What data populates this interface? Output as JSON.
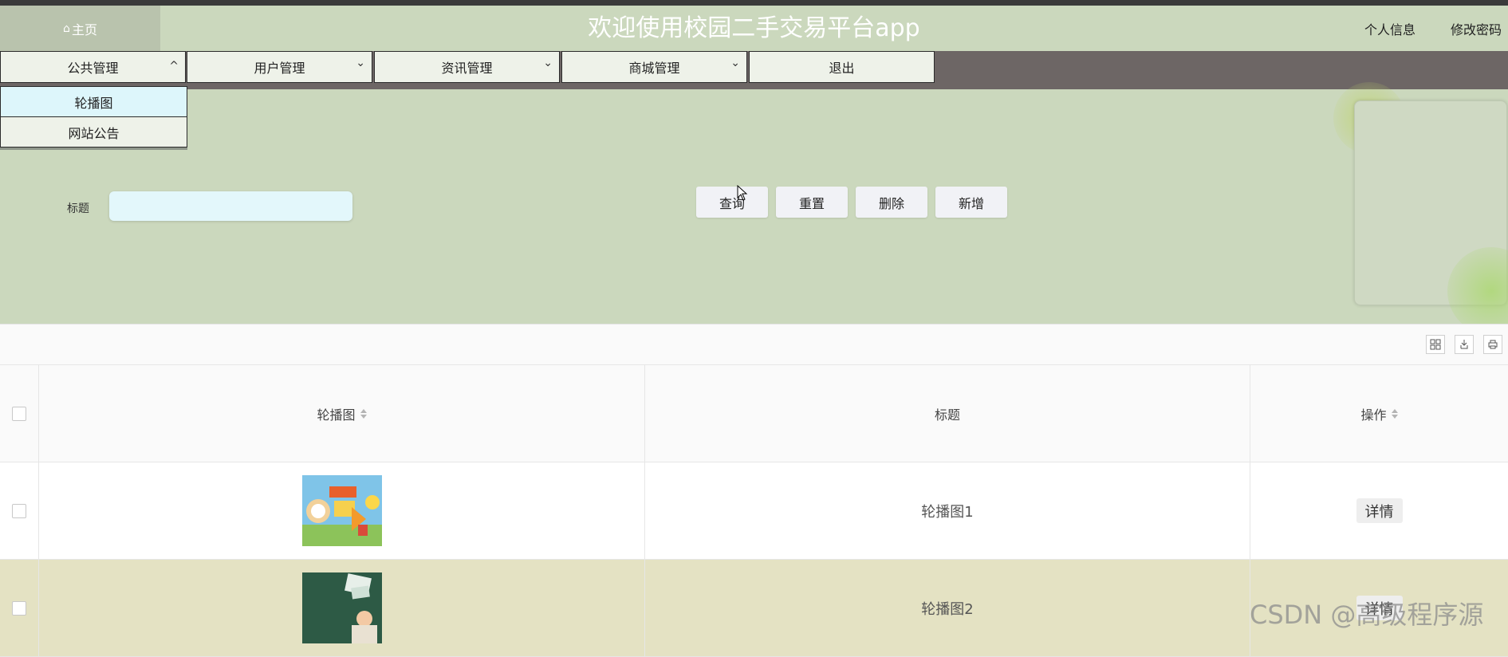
{
  "header": {
    "home_label": "主页",
    "home_icon": "home-icon",
    "title": "欢迎使用校园二手交易平台app",
    "profile_link": "个人信息",
    "password_link": "修改密码"
  },
  "nav": {
    "items": [
      {
        "label": "公共管理",
        "icon": "chevron-up-icon",
        "glyph": "^"
      },
      {
        "label": "用户管理",
        "icon": "chevron-down-icon",
        "glyph": "⌄"
      },
      {
        "label": "资讯管理",
        "icon": "chevron-down-icon",
        "glyph": "⌄"
      },
      {
        "label": "商城管理",
        "icon": "chevron-down-icon",
        "glyph": "⌄"
      },
      {
        "label": "退出"
      }
    ],
    "dropdown": [
      {
        "label": "轮播图",
        "active": true
      },
      {
        "label": "网站公告",
        "active": false
      }
    ]
  },
  "search": {
    "label": "标题",
    "value": "",
    "placeholder": "",
    "buttons": {
      "query": "查询",
      "reset": "重置",
      "delete": "删除",
      "add": "新增"
    }
  },
  "table": {
    "columns": {
      "image": "轮播图",
      "title": "标题",
      "operation": "操作"
    },
    "rows": [
      {
        "title": "轮播图1",
        "action": "详情",
        "image_theme": "cartoon-banner"
      },
      {
        "title": "轮播图2",
        "action": "详情",
        "image_theme": "chalkboard-banner"
      }
    ]
  },
  "watermark": "CSDN @高级程序源",
  "colors": {
    "background": "#cbd8bd",
    "nav_bar": "#6d6665",
    "active_dropdown": "#ddf6fb",
    "row_alt": "#e4e2c3"
  }
}
